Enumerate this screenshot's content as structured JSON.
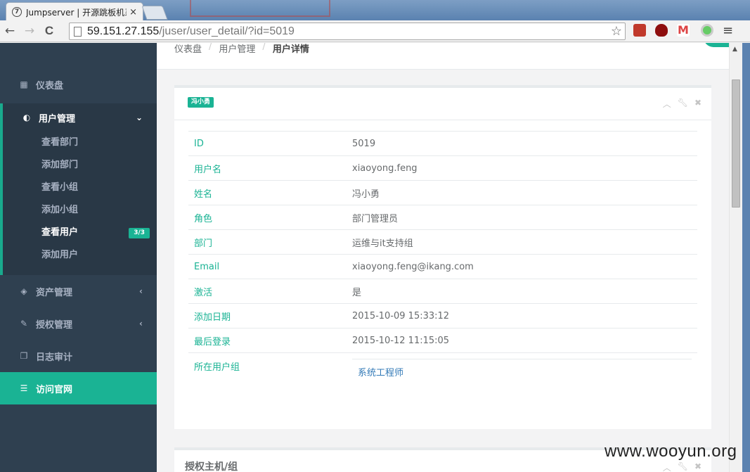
{
  "browser": {
    "tab_title": "Jumpserver | 开源跳板机系",
    "tab_favicon": "7",
    "tab_close": "×",
    "url_host": "59.151.27.155",
    "url_path": "/juser/user_detail/?id=5019",
    "back": "←",
    "forward": "→",
    "reload": "C",
    "star": "☆",
    "menu": "≡"
  },
  "sidebar": {
    "items": [
      {
        "label": "仪表盘",
        "icon": "grid-icon"
      },
      {
        "label": "资产管理",
        "icon": "cube-icon"
      },
      {
        "label": "授权管理",
        "icon": "edit-icon"
      },
      {
        "label": "日志审计",
        "icon": "files-icon"
      },
      {
        "label": "访问官网",
        "icon": "database-icon"
      }
    ],
    "group": {
      "label": "用户管理",
      "icon": "rebel-icon",
      "subitems": [
        {
          "label": "查看部门"
        },
        {
          "label": "添加部门"
        },
        {
          "label": "查看小组"
        },
        {
          "label": "添加小组"
        },
        {
          "label": "查看用户",
          "badge": "3/3"
        },
        {
          "label": "添加用户"
        }
      ]
    }
  },
  "breadcrumb": {
    "home": "仪表盘",
    "parent": "用户管理",
    "current": "用户详情",
    "sep": "/"
  },
  "detail": {
    "badge": "冯小勇",
    "rows": [
      {
        "key": "ID",
        "value": "5019"
      },
      {
        "key": "用户名",
        "value": "xiaoyong.feng"
      },
      {
        "key": "姓名",
        "value": "冯小勇"
      },
      {
        "key": "角色",
        "value": "部门管理员"
      },
      {
        "key": "部门",
        "value": "运维与it支持组"
      },
      {
        "key": "Email",
        "value": "xiaoyong.feng@ikang.com"
      },
      {
        "key": "激活",
        "value": "是"
      },
      {
        "key": "添加日期",
        "value": "2015-10-09 15:33:12"
      },
      {
        "key": "最后登录",
        "value": "2015-10-12 11:15:05"
      }
    ],
    "group_key": "所在用户组",
    "group_value": "系统工程师"
  },
  "second_box": {
    "title": "授权主机/组"
  },
  "watermark": "www.wooyun.org"
}
